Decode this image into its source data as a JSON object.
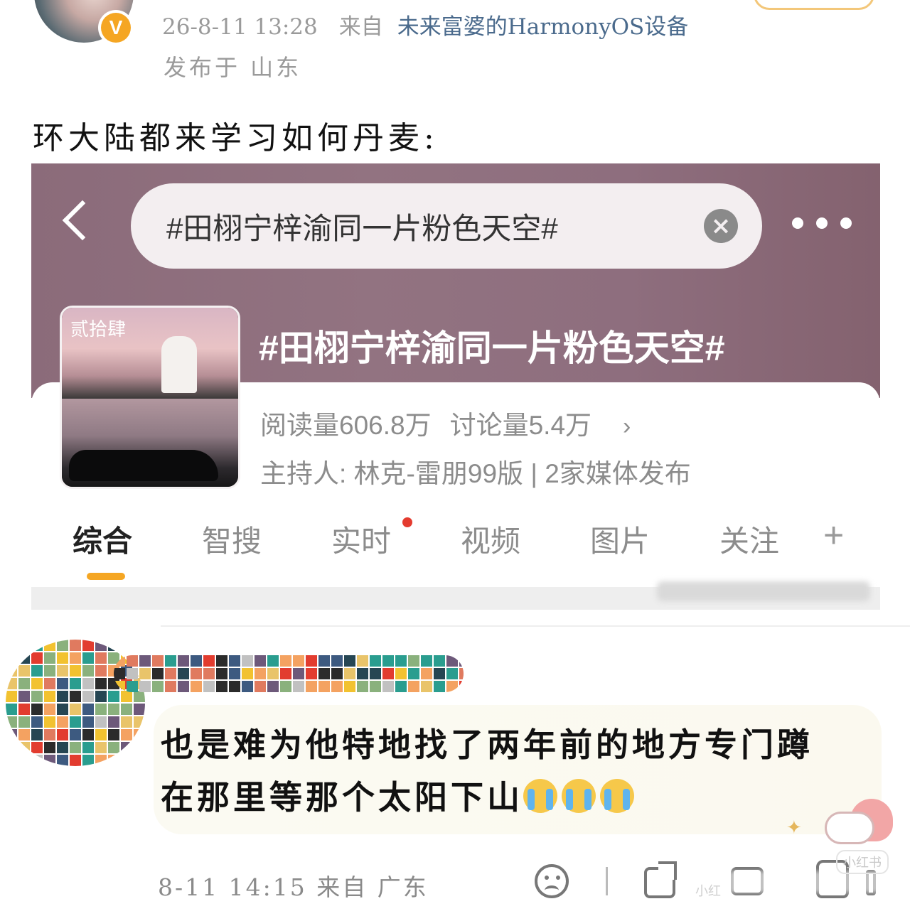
{
  "post": {
    "timestamp": "26-8-11 13:28",
    "from_label": "来自",
    "source": "未来富婆的HarmonyOS设备",
    "location": "发布于 山东",
    "verified_badge": "V",
    "text": "环大陆都来学习如何丹麦:"
  },
  "embed": {
    "search_query": "#田栩宁梓渝同一片粉色天空#",
    "clear_icon": "×",
    "topic_title": "#田栩宁梓渝同一片粉色天空#",
    "reads": "阅读量606.8万",
    "discussions": "讨论量5.4万",
    "chevron": "›",
    "host_line": "主持人: 林克-雷朋99版 | 2家媒体发布",
    "thumb_caption": "贰拾肆",
    "tabs": [
      {
        "label": "综合",
        "active": true
      },
      {
        "label": "智搜",
        "active": false
      },
      {
        "label": "实时",
        "active": false
      },
      {
        "label": "视频",
        "active": false
      },
      {
        "label": "图片",
        "active": false
      },
      {
        "label": "关注",
        "active": false
      }
    ],
    "tab_plus": "+",
    "accent_color": "#f5a623",
    "header_color": "#8b6b7a"
  },
  "comment": {
    "line1": "也是难为他特地找了两年前的地方专门蹲",
    "line2": "在那里等那个太阳下山",
    "emoji": "loudly-crying-face",
    "emoji_count": 3,
    "time": "8-11 14:15",
    "from_label": "来自",
    "location": "广东",
    "watermark": "小红书",
    "watermark2": "小红"
  }
}
